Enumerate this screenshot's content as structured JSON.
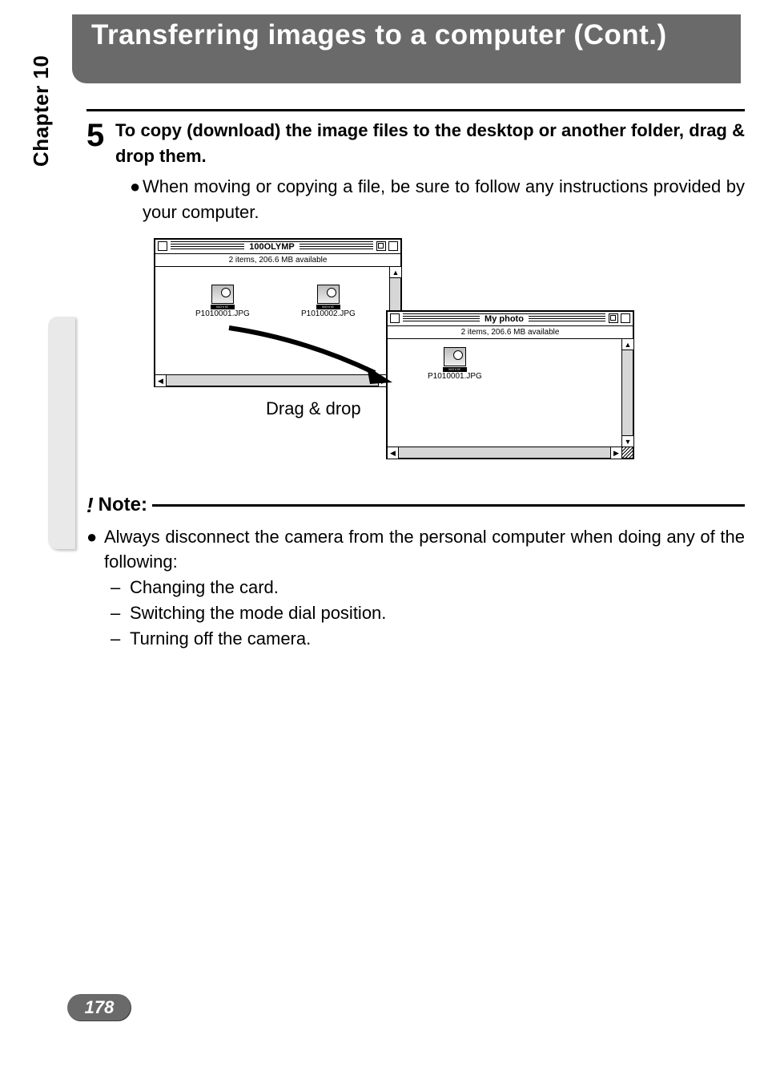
{
  "header": {
    "title": "Transferring images to a computer (Cont.)"
  },
  "side_tab": "Chapter 10",
  "step": {
    "number": "5",
    "bold": "To copy (download) the image files to the desktop or another folder, drag & drop them.",
    "bullet": "When moving or copying a file, be sure to follow any instructions provided by your computer."
  },
  "figure": {
    "win1": {
      "title": "100OLYMP",
      "status": "2 items, 206.6 MB available",
      "files": [
        "P1010001.JPG",
        "P1010002.JPG"
      ]
    },
    "win2": {
      "title": "My photo",
      "status": "2 items, 206.6 MB available",
      "files": [
        "P1010001.JPG"
      ]
    },
    "drag_label": "Drag & drop",
    "icon_strip": "MOVIE"
  },
  "note": {
    "title": "Note:",
    "bullet": "Always disconnect the camera from the personal computer when doing any of the following:",
    "subs": [
      "Changing the card.",
      "Switching the mode dial position.",
      "Turning off the camera."
    ]
  },
  "page_number": "178"
}
